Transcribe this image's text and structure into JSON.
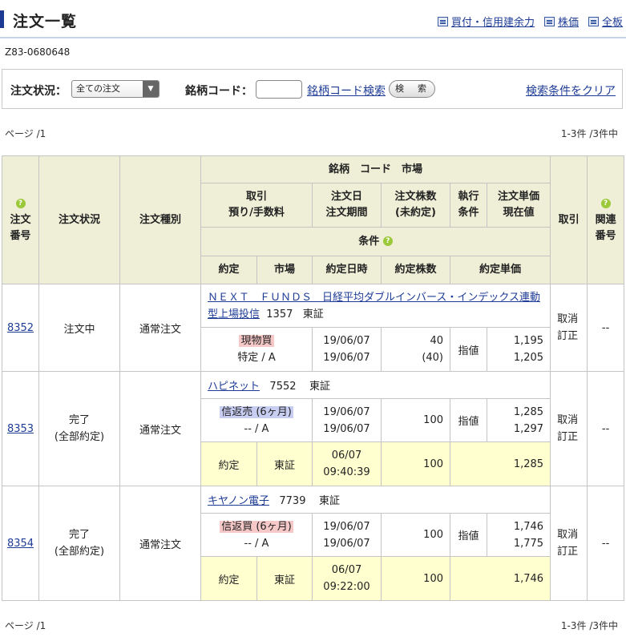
{
  "header": {
    "title": "注文一覧",
    "links": [
      {
        "label": "買付・信用建余力",
        "icon": "document-icon"
      },
      {
        "label": "株価",
        "icon": "window-icon"
      },
      {
        "label": "全板",
        "icon": "window-icon"
      }
    ]
  },
  "account_id": "Z83-0680648",
  "search": {
    "status_label": "注文状況：",
    "status_value": "全ての注文",
    "code_label": "銘柄コード：",
    "code_value": "",
    "code_search_link": "銘柄コード検索",
    "search_button": "検　索",
    "clear_link": "検索条件をクリア"
  },
  "pagination": {
    "page_text": "ページ /1",
    "count_text": "1-3件 /3件中"
  },
  "table": {
    "headers": {
      "order_no": [
        "注文",
        "番号"
      ],
      "status": "注文状況",
      "type": "注文種別",
      "meigara": "銘柄　コード　市場",
      "torihiki": [
        "取引",
        "預り/手数料"
      ],
      "order_date": [
        "注文日",
        "注文期間"
      ],
      "qty": [
        "注文株数",
        "(未約定)"
      ],
      "exec_cond": [
        "執行",
        "条件"
      ],
      "price": [
        "注文単価",
        "現在値"
      ],
      "condition": "条件",
      "yakujo": "約定",
      "market": "市場",
      "yakujo_dt": "約定日時",
      "yakujo_qty": "約定株数",
      "yakujo_price": "約定単価",
      "action": "取引",
      "related": [
        "関連",
        "番号"
      ]
    },
    "rows": [
      {
        "order_no": "8352",
        "status": [
          "注文中"
        ],
        "type": "通常注文",
        "name": "ＮＥＸＴ　ＦＵＮＤＳ　日経平均ダブルインバース・インデックス連動型上場投信",
        "code": "1357",
        "market": "東証",
        "trade": "現物買",
        "account": "特定 / A",
        "order_date": "19/06/07",
        "period": "19/06/07",
        "qty": "40",
        "unfilled": "(40)",
        "exec": "指値",
        "price": "1,195",
        "current": "1,205",
        "actions": [
          "取消",
          "訂正"
        ],
        "related": "--",
        "fill": null
      },
      {
        "order_no": "8353",
        "status": [
          "完了",
          "(全部約定)"
        ],
        "type": "通常注文",
        "name": "ハピネット",
        "code": "7552",
        "market": "東証",
        "trade": "信返売 (6ヶ月)",
        "account": "-- / A",
        "order_date": "19/06/07",
        "period": "19/06/07",
        "qty": "100",
        "unfilled": "",
        "exec": "指値",
        "price": "1,285",
        "current": "1,297",
        "actions": [
          "取消",
          "訂正"
        ],
        "related": "--",
        "fill": {
          "label": "約定",
          "market": "東証",
          "date": "06/07",
          "time": "09:40:39",
          "qty": "100",
          "price": "1,285"
        }
      },
      {
        "order_no": "8354",
        "status": [
          "完了",
          "(全部約定)"
        ],
        "type": "通常注文",
        "name": "キヤノン電子",
        "code": "7739",
        "market": "東証",
        "trade": "信返買 (6ヶ月)",
        "account": "-- / A",
        "order_date": "19/06/07",
        "period": "19/06/07",
        "qty": "100",
        "unfilled": "",
        "exec": "指値",
        "price": "1,746",
        "current": "1,775",
        "actions": [
          "取消",
          "訂正"
        ],
        "related": "--",
        "fill": {
          "label": "約定",
          "market": "東証",
          "date": "06/07",
          "time": "09:22:00",
          "qty": "100",
          "price": "1,746"
        }
      }
    ]
  },
  "colors": {
    "accent": "#1d3b93",
    "header_bg": "#efefd8",
    "fill_bg": "#ffffd0",
    "buy_tag": "#f6c8c8",
    "sell_tag": "#c8cdf2"
  }
}
